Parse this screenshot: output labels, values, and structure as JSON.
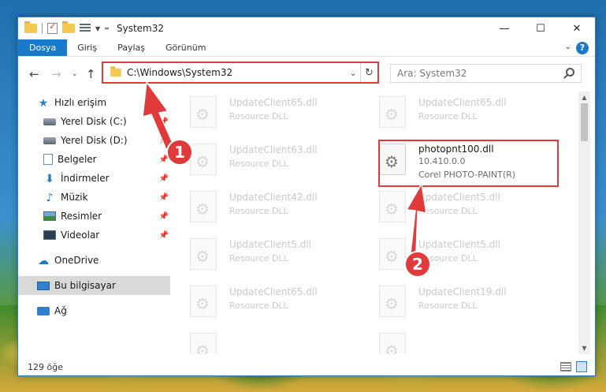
{
  "window": {
    "title": "System32",
    "controls": {
      "minimize": "—",
      "maximize": "☐",
      "close": "✕"
    }
  },
  "ribbon": {
    "tabs": [
      "Dosya",
      "Giriş",
      "Paylaş",
      "Görünüm"
    ]
  },
  "address": {
    "path": "C:\\Windows\\System32",
    "refresh_icon": "refresh-icon"
  },
  "search": {
    "placeholder": "Ara: System32"
  },
  "sidebar": {
    "items": [
      {
        "label": "Hızlı erişim",
        "icon": "star-icon"
      },
      {
        "label": "Yerel Disk (C:)",
        "icon": "disk-icon",
        "pinned": true
      },
      {
        "label": "Yerel Disk (D:)",
        "icon": "disk-icon",
        "pinned": true
      },
      {
        "label": "Belgeler",
        "icon": "documents-icon",
        "pinned": true
      },
      {
        "label": "İndirmeler",
        "icon": "downloads-icon",
        "pinned": true
      },
      {
        "label": "Müzik",
        "icon": "music-icon",
        "pinned": true
      },
      {
        "label": "Resimler",
        "icon": "pictures-icon",
        "pinned": true
      },
      {
        "label": "Videolar",
        "icon": "videos-icon",
        "pinned": true
      },
      {
        "label": "OneDrive",
        "icon": "cloud-icon"
      },
      {
        "label": "Bu bilgisayar",
        "icon": "computer-icon",
        "selected": true
      },
      {
        "label": "Ağ",
        "icon": "network-icon"
      }
    ]
  },
  "files": {
    "left": [
      {
        "name": "UpdateClient65.dll",
        "desc": "Resource DLL"
      },
      {
        "name": "UpdateClient63.dll",
        "desc": "Resource DLL"
      },
      {
        "name": "UpdateClient42.dll",
        "desc": "Resource DLL"
      },
      {
        "name": "UpdateClient5.dll",
        "desc": "Resource DLL"
      },
      {
        "name": "UpdateClient65.dll",
        "desc": "Resource DLL"
      },
      {
        "name": "",
        "desc": ""
      }
    ],
    "right": [
      {
        "name": "UpdateClient65.dll",
        "desc": "Resource DLL"
      },
      {
        "name": "photopnt100.dll",
        "version": "10.410.0.0",
        "desc": "Corel PHOTO-PAINT(R)",
        "highlighted": true
      },
      {
        "name": "UpdateClient5.dll",
        "desc": "Resource DLL"
      },
      {
        "name": "UpdateClient5.dll",
        "desc": "Resource DLL"
      },
      {
        "name": "UpdateClient19.dll",
        "desc": "Resource DLL"
      },
      {
        "name": "",
        "desc": ""
      }
    ]
  },
  "status": {
    "count": "129 öğe"
  },
  "annotations": {
    "step1": "1",
    "step2": "2",
    "color": "#e03a3a"
  }
}
